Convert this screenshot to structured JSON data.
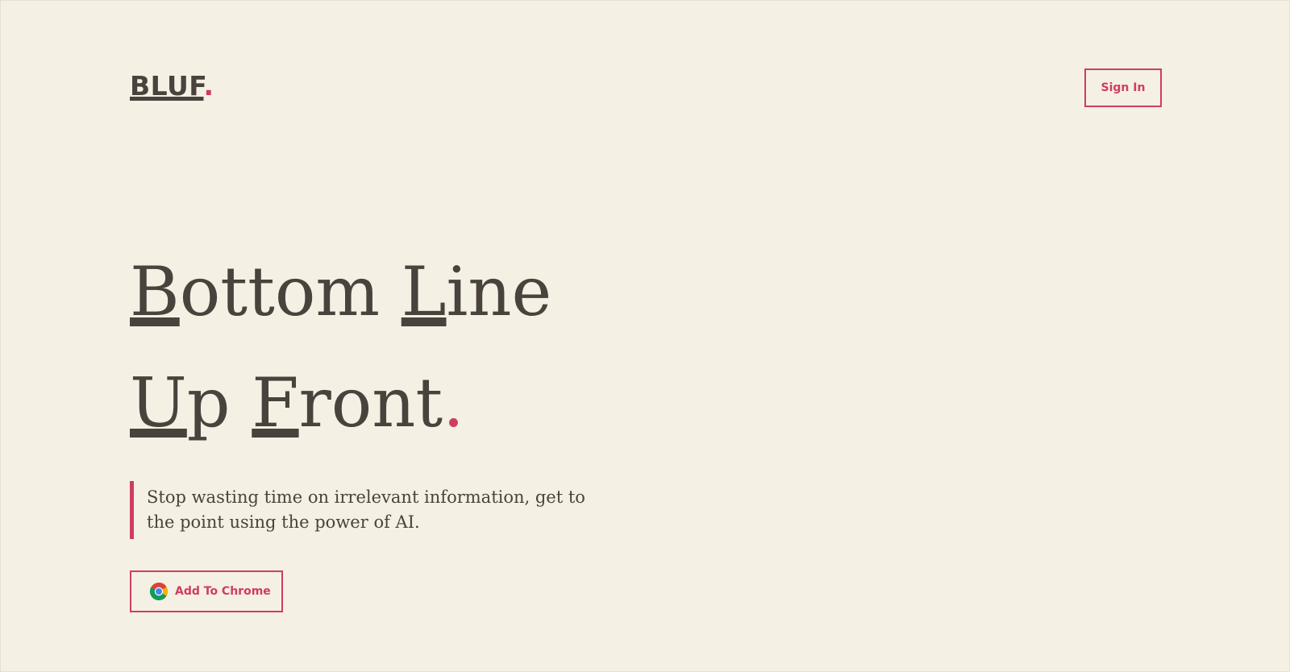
{
  "header": {
    "logo_text": "BLUF",
    "logo_dot": ".",
    "signin_label": "Sign In"
  },
  "hero": {
    "line1": [
      {
        "cap": "B",
        "rest": "ottom "
      },
      {
        "cap": "L",
        "rest": "ine"
      }
    ],
    "line2": [
      {
        "cap": "U",
        "rest": "p "
      },
      {
        "cap": "F",
        "rest": "ront"
      }
    ],
    "headline_dot": ".",
    "tagline": "Stop wasting time on irrelevant information, get to the point using the power of AI.",
    "cta_label": "Add To Chrome",
    "cta_icon": "chrome-icon"
  },
  "colors": {
    "background": "#f5f0e4",
    "text": "#4a423d",
    "accent": "#cf3d5e"
  }
}
